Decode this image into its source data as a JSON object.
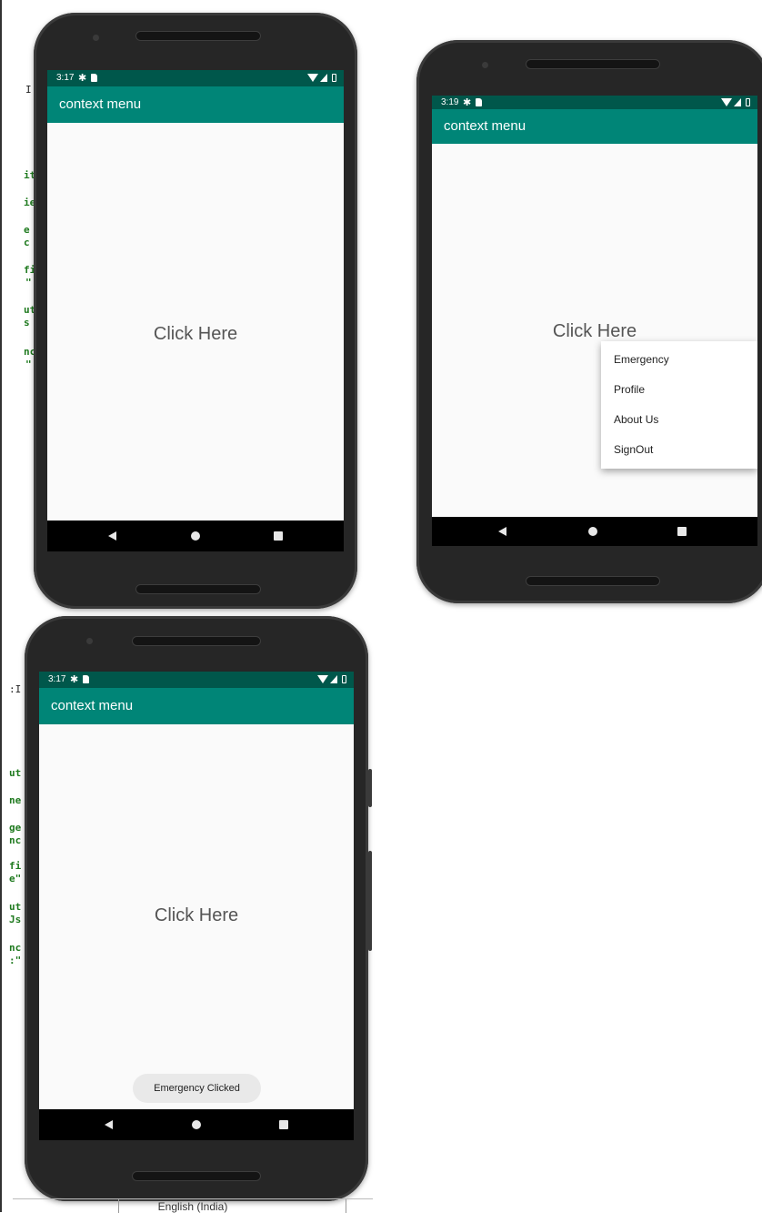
{
  "screens": [
    {
      "time": "3:17",
      "app_title": "context menu",
      "center_label": "Click Here"
    },
    {
      "time": "3:19",
      "app_title": "context menu",
      "center_label": "Click Here",
      "context_menu": [
        "Emergency",
        "Profile",
        "About Us",
        "SignOut"
      ]
    },
    {
      "time": "3:17",
      "app_title": "context menu",
      "center_label": "Click Here",
      "toast": "Emergency Clicked"
    }
  ],
  "background_code": {
    "top": [
      "I",
      "",
      "",
      "",
      "",
      "it",
      "",
      "ie",
      "",
      "e",
      "c",
      "",
      "fi",
      "\"",
      "",
      "ut",
      "s",
      "",
      "nc",
      "\""
    ],
    "bottom": [
      ":I",
      "",
      "",
      "",
      "",
      "ut",
      "",
      "ne",
      "",
      "ge",
      "nc",
      "",
      "fi",
      "e\"",
      "",
      "ut",
      "Js",
      "",
      "nc",
      ":\""
    ]
  },
  "footer": {
    "language": "English (India)"
  },
  "colors": {
    "primary": "#008577",
    "primary_dark": "#00574b",
    "background": "#fafafa",
    "nav_bar": "#000000"
  },
  "icons": [
    "gear-icon",
    "sd-card-icon",
    "wifi-icon",
    "signal-icon",
    "battery-icon",
    "back-icon",
    "home-icon",
    "recents-icon"
  ]
}
